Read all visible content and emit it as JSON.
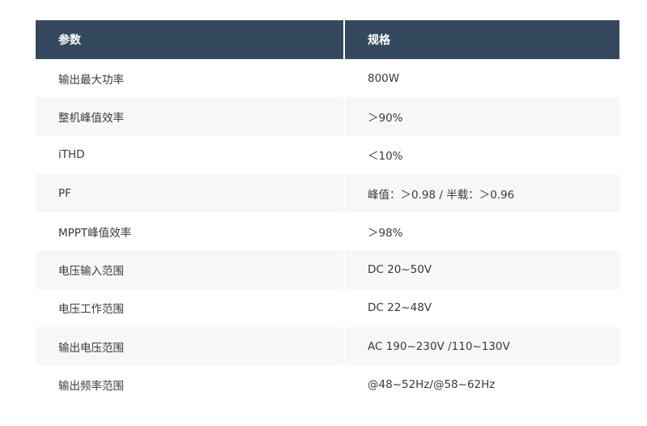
{
  "table": {
    "headers": {
      "param": "参数",
      "spec": "规格"
    },
    "rows": [
      {
        "param": "输出最大功率",
        "spec": "800W"
      },
      {
        "param": "整机峰值效率",
        "spec": "＞90%"
      },
      {
        "param": "iTHD",
        "spec": "＜10%"
      },
      {
        "param": "PF",
        "spec": "峰值：＞0.98 / 半载：＞0.96"
      },
      {
        "param": "MPPT峰值效率",
        "spec": "＞98%"
      },
      {
        "param": "电压输入范围",
        "spec": "DC 20~50V"
      },
      {
        "param": "电压工作范围",
        "spec": "DC 22~48V"
      },
      {
        "param": "输出电压范围",
        "spec": "AC 190~230V /110~130V"
      },
      {
        "param": "输出频率范围",
        "spec": "@48~52Hz/@58~62Hz"
      }
    ]
  },
  "colors": {
    "header_bg": "#34495e",
    "header_text": "#ffffff",
    "stripe_bg": "#f7f7f7"
  }
}
